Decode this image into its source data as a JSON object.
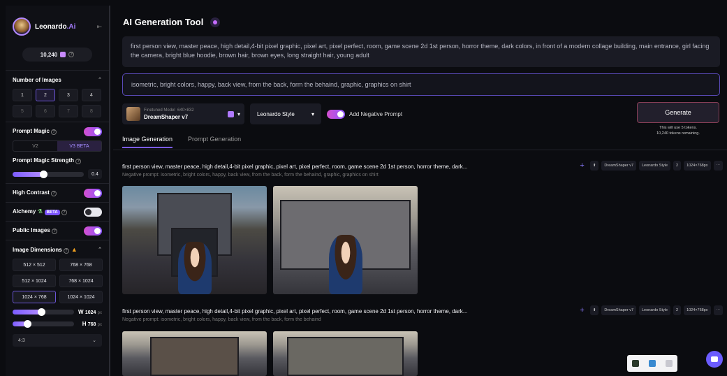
{
  "sidebar": {
    "brand": "Leonardo",
    "brand_ai": ".Ai",
    "collapse_icon": "collapse-arrow-icon",
    "tokens": "10,240",
    "number_of_images": {
      "label": "Number of Images",
      "options": [
        "1",
        "2",
        "3",
        "4",
        "5",
        "6",
        "7",
        "8"
      ],
      "selected": "2"
    },
    "prompt_magic": {
      "label": "Prompt Magic",
      "on": true,
      "versions": [
        "V2",
        "V3 BETA"
      ],
      "selected": "V3 BETA"
    },
    "prompt_magic_strength": {
      "label": "Prompt Magic Strength",
      "value": "0.4"
    },
    "high_contrast": {
      "label": "High Contrast",
      "on": true
    },
    "alchemy": {
      "label": "Alchemy",
      "badge": "BETA",
      "on": false
    },
    "public_images": {
      "label": "Public Images",
      "on": true
    },
    "image_dimensions": {
      "label": "Image Dimensions",
      "options": [
        "512 × 512",
        "768 × 768",
        "512 × 1024",
        "768 × 1024",
        "1024 × 768",
        "1024 × 1024"
      ],
      "selected": "1024 × 768"
    },
    "width": {
      "label": "W",
      "value": "1024",
      "unit": "px"
    },
    "height": {
      "label": "H",
      "value": "768",
      "unit": "px"
    },
    "aspect_ratio": "4:3"
  },
  "main": {
    "title": "AI Generation Tool",
    "prompt": "first person view, master peace, high detail,4-bit pixel graphic, pixel art, pixel perfect, room, game scene 2d 1st person, horror theme, dark colors, in front of a modern collage building, main entrance, girl facing the camera, bright blue hoodie, brown hair, brown eyes, long straight hair, young adult",
    "negative_prompt": "isometric, bright colors, happy, back view, from the back, form the behaind, graphic, graphics on shirt",
    "model": {
      "caption": "Finetuned Model",
      "size": "640×832",
      "name": "DreamShaper v7"
    },
    "style": "Leonardo Style",
    "add_negative_prompt": "Add Negative Prompt",
    "generate": "Generate",
    "generate_note_1": "This will use 5 tokens.",
    "generate_note_2": "10,240 tokens remaining.",
    "tabs": [
      "Image Generation",
      "Prompt Generation"
    ],
    "generations": [
      {
        "prompt": "first person view, master peace, high detail,4-bit pixel graphic, pixel art, pixel perfect, room, game scene 2d 1st person, horror theme, dark...",
        "negative": "Negative prompt: isometric, bright colors, happy, back view, from the back, form the behaind, graphic, graphics on shirt",
        "tags": [
          "DreamShaper v7",
          "Leonardo Style",
          "2",
          "1024×768px"
        ]
      },
      {
        "prompt": "first person view, master peace, high detail,4-bit pixel graphic, pixel art, pixel perfect, room, game scene 2d 1st person, horror theme, dark...",
        "negative": "Negative prompt: isometric, bright colors, happy, back view, from the back, form the behaind",
        "tags": [
          "DreamShaper v7",
          "Leonardo Style",
          "2",
          "1024×768px"
        ]
      }
    ]
  },
  "colors": {
    "accent": "#7c5cff",
    "toggle_on": "#d44fcf",
    "generate_border": "#8a3f58"
  }
}
